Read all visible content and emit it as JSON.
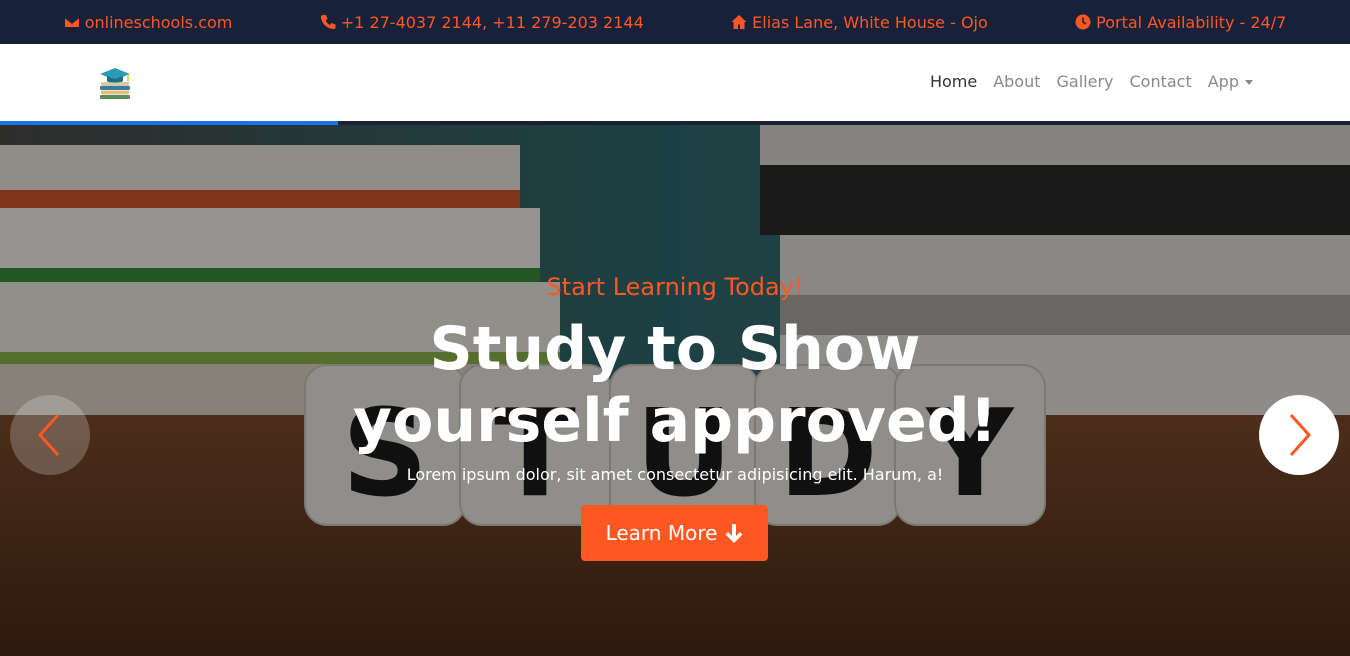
{
  "topbar": {
    "email": "onlineschools.com",
    "phone": "+1 27-4037 2144, +11 279-203 2144",
    "address": "Elias Lane, White House - Ojo",
    "availability": "Portal Availability - 24/7",
    "accent": "#ff5722",
    "background": "#18213a"
  },
  "nav": {
    "links": [
      "Home",
      "About",
      "Gallery",
      "Contact",
      "App"
    ],
    "active": "Home"
  },
  "progress": {
    "value": 0.25
  },
  "hero": {
    "kicker": "Start Learning Today!",
    "headline_line1": "Study to Show",
    "headline_line2": "yourself approved!",
    "subtext": "Lorem ipsum dolor, sit amet consectetur adipisicing elit. Harum, a!",
    "cta_label": "Learn More",
    "dice_letters": [
      "S",
      "T",
      "U",
      "D",
      "Y"
    ]
  },
  "icons": {
    "email": "envelope-icon",
    "phone": "phone-icon",
    "address": "home-icon",
    "availability": "clock-icon",
    "logo": "graduation-books-icon",
    "cta": "arrow-down-icon",
    "prev": "chevron-left-icon",
    "next": "chevron-right-icon"
  }
}
